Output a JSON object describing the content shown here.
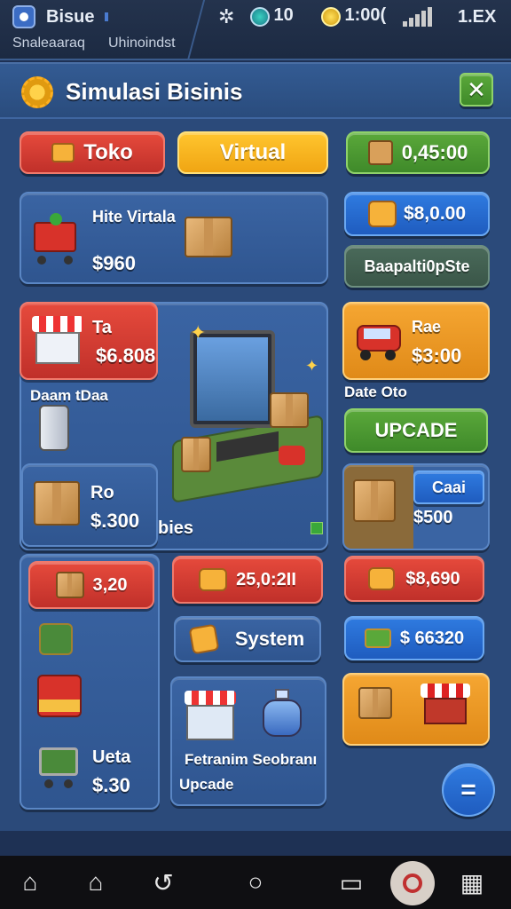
{
  "status": {
    "app_name": "Bisue",
    "sub_left": "Snaleaaraq",
    "sub_right": "Uhinoindst",
    "gems": "10",
    "coins": "1:00(",
    "speed": "1.EX"
  },
  "window": {
    "title": "Simulasi Bisinis",
    "close_label": "✕"
  },
  "tabs": {
    "toko": "Toko",
    "virtual": "Virtual",
    "balance": "0,45:00"
  },
  "cards": {
    "hire": {
      "title": "Hite Virtala",
      "price": "$960"
    },
    "right_value_1": "$8,0.00",
    "right_label_1": "Baapalti0pSte",
    "shop": {
      "title": "Ta",
      "price": "$6.808"
    },
    "shop_sub": "Daam tDaa",
    "truck": {
      "title": "Rae",
      "price": "$3:00"
    },
    "truck_sub": "Date Oto",
    "update_button": "UPCADE",
    "box_card": {
      "title": "Ro",
      "price": "$.300"
    },
    "bies_label": "bies",
    "cart_card": {
      "badge": "Caai",
      "price": "$500"
    },
    "left_red": "3,20",
    "mid_red": "25,0:2II",
    "system_button": "System",
    "right_red": "$8,690",
    "right_blue": "$ 66320",
    "bottom_left": {
      "title": "Ueta",
      "price": "$.30"
    },
    "bottom_mid": {
      "line1": "Fetranim Seobranı",
      "line2": "Upcade"
    },
    "fab_label": "="
  },
  "colors": {
    "window_bg": "#2b4a7a",
    "accent_red": "#e64a3c",
    "accent_yellow": "#ffc52e",
    "accent_green": "#5aa83a",
    "accent_blue": "#2f7be0",
    "accent_orange": "#f5a632"
  },
  "nav": [
    "home-icon",
    "home-outline-icon",
    "back-icon",
    "circle-home-icon",
    "chat-icon",
    "search-icon",
    "grid-icon"
  ]
}
